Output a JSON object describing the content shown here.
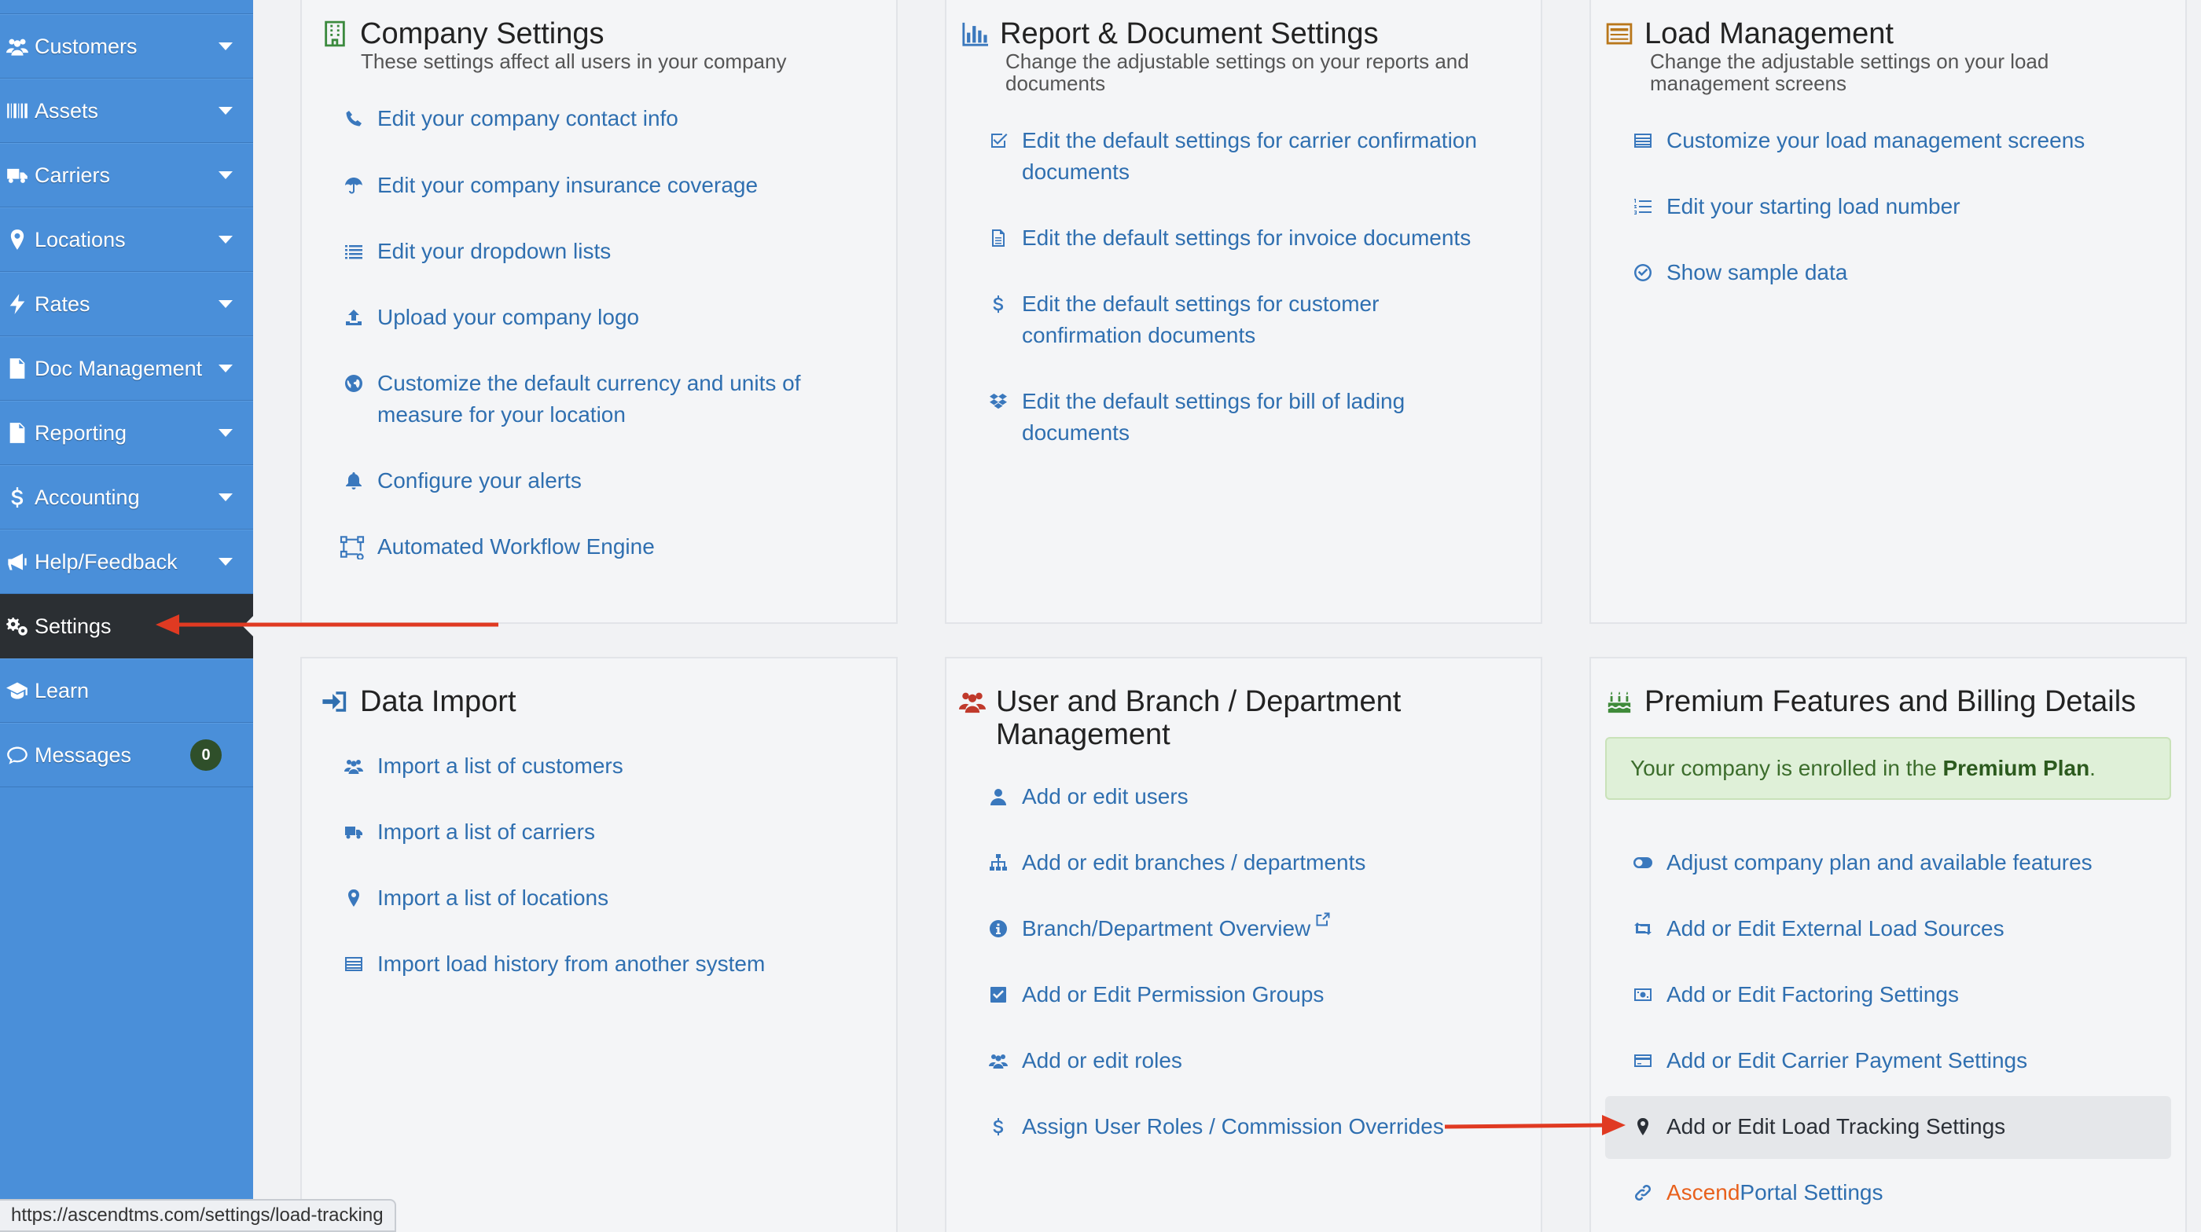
{
  "sidebar": {
    "items": [
      {
        "id": "customers",
        "label": "Customers",
        "icon": "users-icon"
      },
      {
        "id": "assets",
        "label": "Assets",
        "icon": "barcode-icon"
      },
      {
        "id": "carriers",
        "label": "Carriers",
        "icon": "truck-icon"
      },
      {
        "id": "locations",
        "label": "Locations",
        "icon": "map-marker-icon"
      },
      {
        "id": "rates",
        "label": "Rates",
        "icon": "bolt-icon"
      },
      {
        "id": "doc-management",
        "label": "Doc Management",
        "icon": "document-icon"
      },
      {
        "id": "reporting",
        "label": "Reporting",
        "icon": "document-icon"
      },
      {
        "id": "accounting",
        "label": "Accounting",
        "icon": "dollar-icon"
      },
      {
        "id": "help-feedback",
        "label": "Help/Feedback",
        "icon": "megaphone-icon"
      },
      {
        "id": "settings",
        "label": "Settings",
        "icon": "gears-icon",
        "active": true
      },
      {
        "id": "learn",
        "label": "Learn",
        "icon": "graduation-cap-icon"
      },
      {
        "id": "messages",
        "label": "Messages",
        "icon": "chat-bubble-icon",
        "badge": "0"
      }
    ]
  },
  "panels": {
    "company_settings": {
      "title": "Company Settings",
      "subtitle": "These settings affect all users in your company",
      "links": [
        "Edit your company contact info",
        "Edit your company insurance coverage",
        "Edit your dropdown lists",
        "Upload your company logo",
        "Customize the default currency and units of measure for your location",
        "Configure your alerts",
        "Automated Workflow Engine"
      ]
    },
    "report_document": {
      "title": "Report & Document Settings",
      "subtitle": "Change the adjustable settings on your reports and documents",
      "links": [
        "Edit the default settings for carrier confirmation documents",
        "Edit the default settings for invoice documents",
        "Edit the default settings for customer confirmation documents",
        "Edit the default settings for bill of lading documents"
      ]
    },
    "load_management": {
      "title": "Load Management",
      "subtitle": "Change the adjustable settings on your load management screens",
      "links": [
        "Customize your load management screens",
        "Edit your starting load number",
        "Show sample data"
      ]
    },
    "data_import": {
      "title": "Data Import",
      "links": [
        "Import a list of customers",
        "Import a list of carriers",
        "Import a list of locations",
        "Import load history from another system"
      ]
    },
    "user_branch": {
      "title": "User and Branch / Department Management",
      "links": [
        "Add or edit users",
        "Add or edit branches / departments",
        "Branch/Department Overview",
        "Add or Edit Permission Groups",
        "Add or edit roles",
        "Assign User Roles / Commission Overrides"
      ]
    },
    "premium": {
      "title": "Premium Features and Billing Details",
      "enrolled_prefix": "Your company is enrolled in the ",
      "plan_name": "Premium Plan",
      "enrolled_suffix": ".",
      "links": [
        "Adjust company plan and available features",
        "Add or Edit External Load Sources",
        "Add or Edit Factoring Settings",
        "Add or Edit Carrier Payment Settings",
        "Add or Edit Load Tracking Settings"
      ],
      "portal_brand": "Ascend",
      "portal_rest": "Portal Settings"
    }
  },
  "status_bar": {
    "url": "https://ascendtms.com/settings/load-tracking"
  },
  "colors": {
    "sidebar": "#4a8fd9",
    "sidebar_active": "#2b2f33",
    "link": "#2f6fb0",
    "annotation_arrow": "#e03a22",
    "brand_orange": "#e8601c"
  }
}
